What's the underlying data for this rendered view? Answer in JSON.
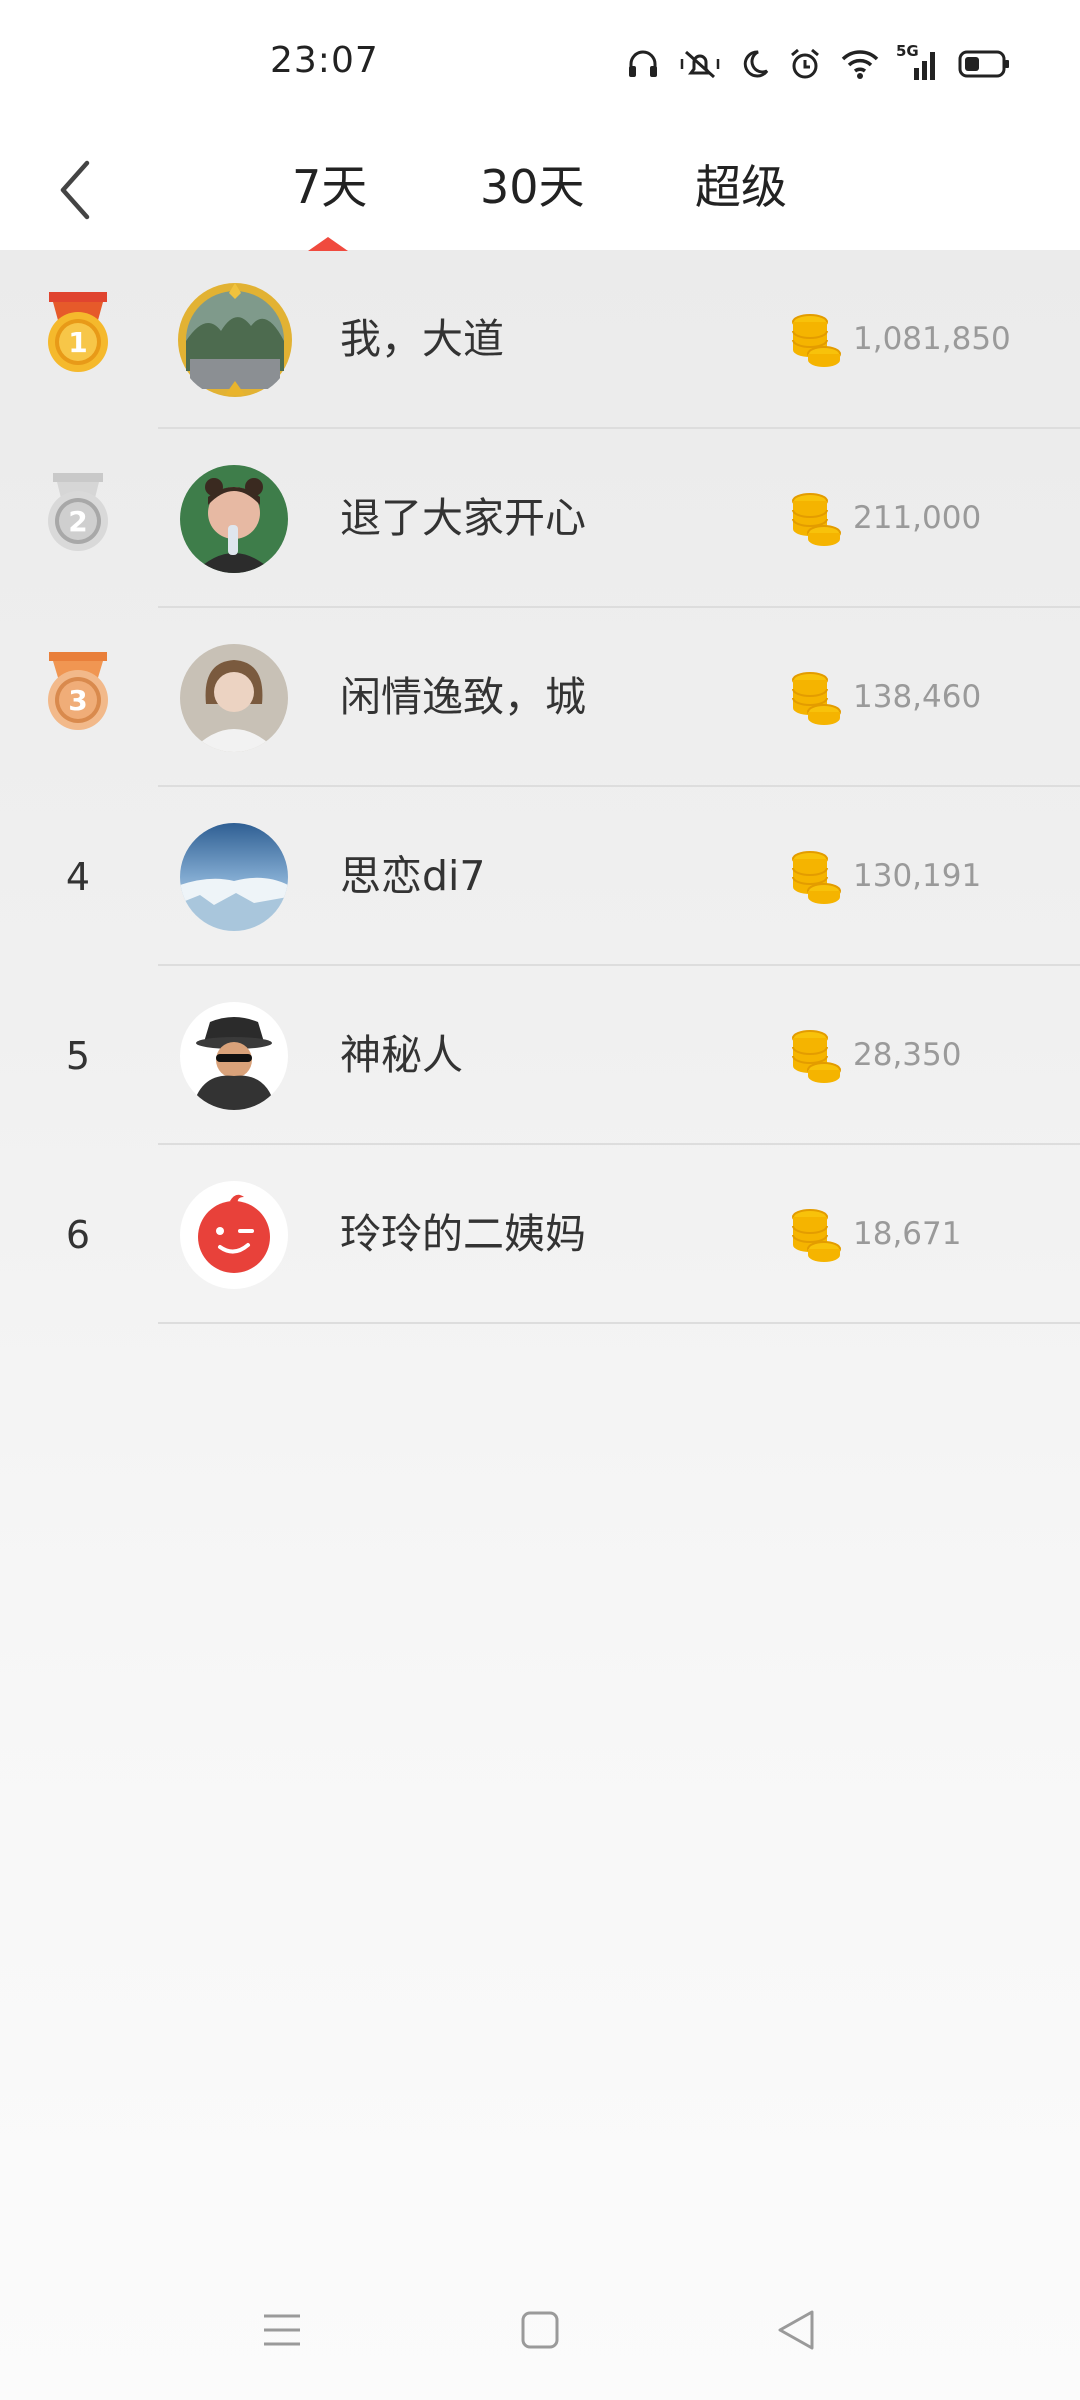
{
  "status_bar": {
    "time": "23:07",
    "icons": [
      "headphones-icon",
      "mute-icon",
      "moon-icon",
      "alarm-icon",
      "wifi-icon",
      "signal-5g-icon",
      "battery-icon"
    ],
    "network_label": "5G"
  },
  "header": {
    "tabs": [
      {
        "label": "7天",
        "selected": true
      },
      {
        "label": "30天",
        "selected": false
      },
      {
        "label": "超级",
        "selected": false
      }
    ],
    "accent_color": "#f04a3e"
  },
  "ranking": [
    {
      "rank": "1",
      "medal": "gold",
      "name": "我，大道",
      "coins": "1,081,850"
    },
    {
      "rank": "2",
      "medal": "silver",
      "name": "退了大家开心",
      "coins": "211,000"
    },
    {
      "rank": "3",
      "medal": "bronze",
      "name": "闲情逸致，城",
      "coins": "138,460"
    },
    {
      "rank": "4",
      "medal": "",
      "name": "思恋di7",
      "coins": "130,191"
    },
    {
      "rank": "5",
      "medal": "",
      "name": "神秘人",
      "coins": "28,350"
    },
    {
      "rank": "6",
      "medal": "",
      "name": "玲玲的二姨妈",
      "coins": "18,671"
    }
  ],
  "nav_bar": {
    "icons": [
      "menu-icon",
      "home-icon",
      "back-icon"
    ]
  }
}
